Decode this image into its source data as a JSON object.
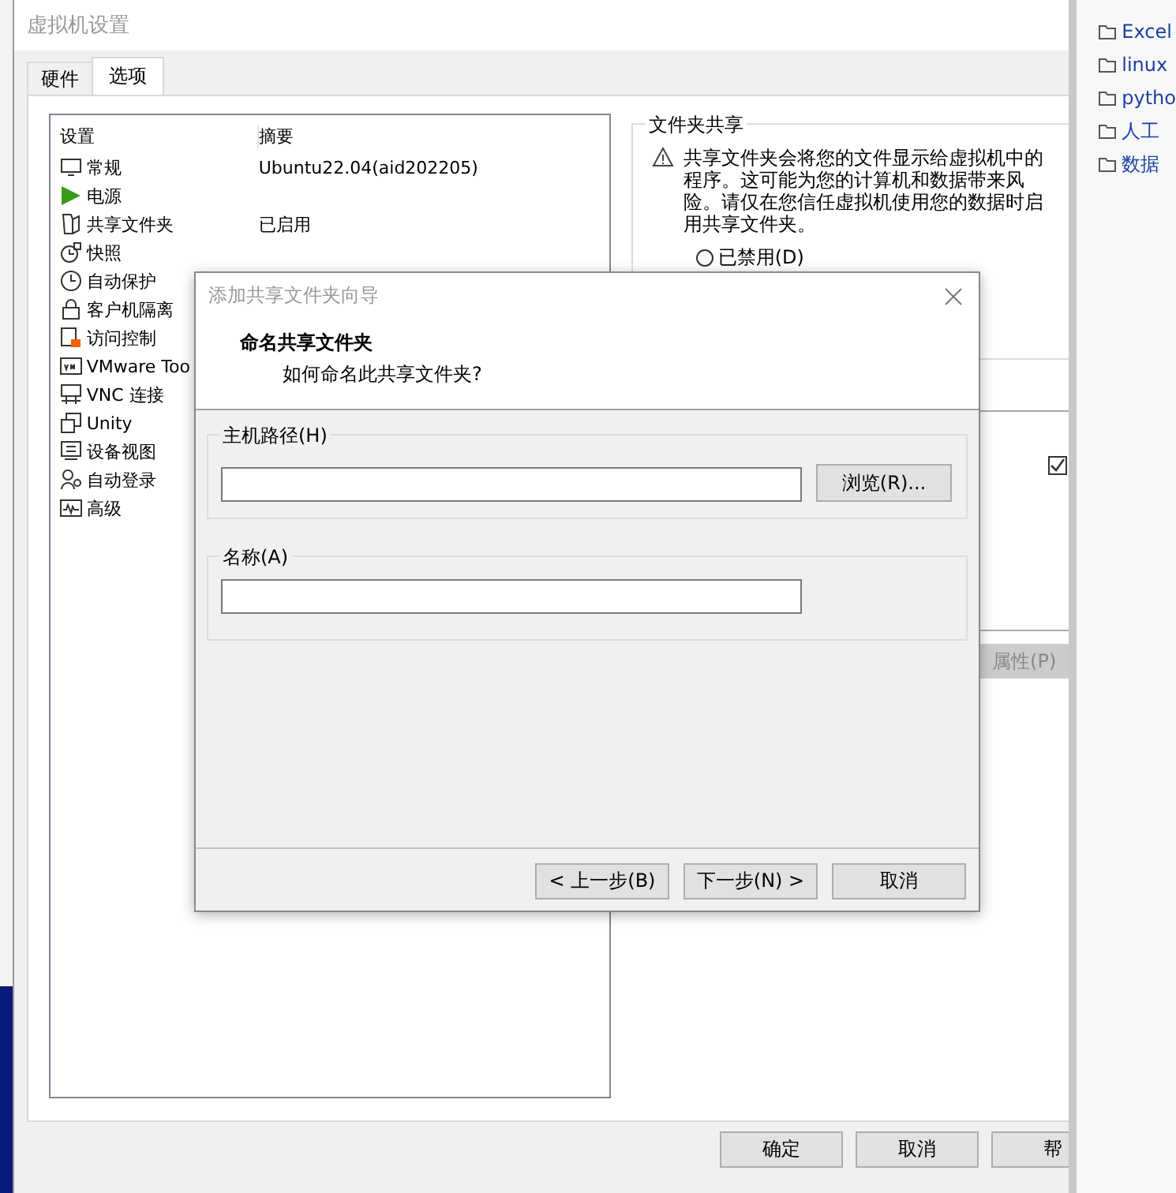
{
  "window": {
    "title": "虚拟机设置"
  },
  "tabs": [
    {
      "label": "硬件",
      "selected": false
    },
    {
      "label": "选项",
      "selected": true
    }
  ],
  "settings_list": {
    "columns": [
      "设置",
      "摘要"
    ],
    "items": [
      {
        "kind": "monitor",
        "name": "常规",
        "summary": "Ubuntu22.04(aid202205)",
        "selected": false
      },
      {
        "kind": "power",
        "name": "电源",
        "selected": false
      },
      {
        "kind": "folder",
        "name": "共享文件夹",
        "summary": "已启用",
        "selected": false
      },
      {
        "kind": "snapshot",
        "name": "快照",
        "selected": false
      },
      {
        "kind": "clock",
        "name": "自动保护",
        "selected": false
      },
      {
        "kind": "lock",
        "name": "客户机隔离",
        "selected": false
      },
      {
        "kind": "access",
        "name": "访问控制",
        "selected": false
      },
      {
        "kind": "vm",
        "name": "VMware Too",
        "selected": false
      },
      {
        "kind": "vnc",
        "name": "VNC 连接",
        "selected": false
      },
      {
        "kind": "window",
        "name": "Unity",
        "selected": false
      },
      {
        "kind": "device",
        "name": "设备视图",
        "selected": false
      },
      {
        "kind": "user",
        "name": "自动登录",
        "selected": false
      },
      {
        "kind": "wave",
        "name": "高级",
        "selected": false
      }
    ]
  },
  "folder_sharing": {
    "title": "文件夹共享",
    "warning": "共享文件夹会将您的文件显示给虚拟机中的程序。这可能为您的计算机和数据带来风险。请仅在您信任虚拟机使用您的数据时启用共享文件夹。",
    "options": [
      {
        "label": "已禁用(D)",
        "selected": false
      }
    ]
  },
  "shares_table": {
    "checked": true
  },
  "properties_button": {
    "label": "属性(P)",
    "disabled": true
  },
  "buttons": [
    "确定",
    "取消",
    "帮"
  ],
  "wizard": {
    "title": "添加共享文件夹向导",
    "heading": "命名共享文件夹",
    "subheading": "如何命名此共享文件夹?",
    "host_path": {
      "label": "主机路径(H)",
      "browse": "浏览(R)..."
    },
    "name": {
      "label": "名称(A)"
    },
    "buttons": [
      "< 上一步(B)",
      "下一步(N) >",
      "取消"
    ]
  },
  "explorer": {
    "items": [
      "Excel",
      "linux",
      "pytho",
      "人工",
      "数据"
    ]
  }
}
